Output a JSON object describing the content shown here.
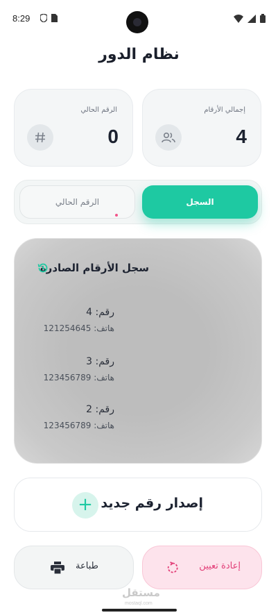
{
  "status_bar": {
    "time": "8:29",
    "icons_left": [
      "shield-icon",
      "sim-card-icon"
    ],
    "icons_right": [
      "wifi-icon",
      "signal-icon",
      "battery-icon"
    ]
  },
  "header": {
    "title": "نظام الدور"
  },
  "stats": {
    "total": {
      "label": "إجمالي الأرقام",
      "value": "4",
      "icon": "people-icon"
    },
    "current": {
      "label": "الرقم الحالي",
      "value": "0",
      "icon": "hash-icon"
    }
  },
  "tabs": [
    {
      "label": "السجل",
      "active": true
    },
    {
      "label": "الرقم الحالي",
      "active": false
    }
  ],
  "history": {
    "title": "سجل الأرقام الصادرة",
    "icon": "history-icon",
    "entries": [
      {
        "number": "رقم: 4",
        "phone": "هاتف: 121254645"
      },
      {
        "number": "رقم: 3",
        "phone": "هاتف: 123456789"
      },
      {
        "number": "رقم: 2",
        "phone": "هاتف: 123456789"
      }
    ]
  },
  "actions": {
    "issue_label": "إصدار رقم جديد",
    "issue_icon": "+",
    "reset_label": "إعادة تعيين",
    "print_label": "طباعة"
  },
  "watermark": {
    "text": "مستقل",
    "sub": "mostaql.com"
  },
  "colors": {
    "accent": "#1ec9a2",
    "danger": "#e23d77",
    "danger_bg": "#fde3ec"
  }
}
